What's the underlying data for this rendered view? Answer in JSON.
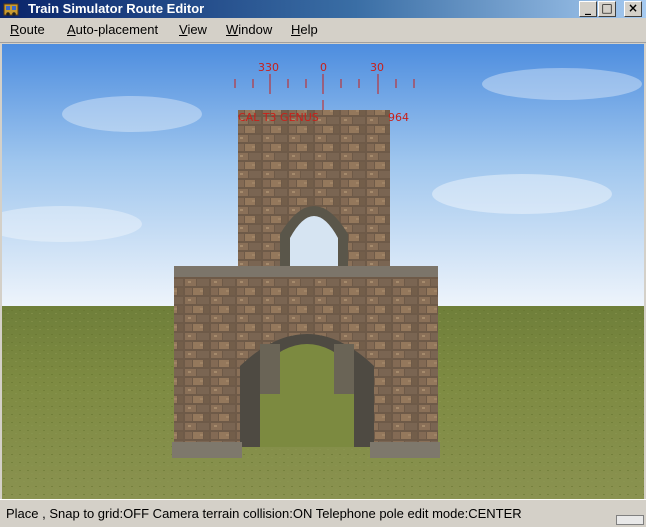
{
  "window": {
    "title": "Train Simulator Route Editor",
    "minimize_glyph": "_",
    "maximize_glyph": "□",
    "close_glyph": "×"
  },
  "menu": {
    "items": [
      {
        "label_first": "R",
        "label_rest": "oute"
      },
      {
        "label_first": "A",
        "label_rest": "uto-placement"
      },
      {
        "label_first": "V",
        "label_rest": "iew"
      },
      {
        "label_first": "W",
        "label_rest": "indow"
      },
      {
        "label_first": "H",
        "label_rest": "elp"
      }
    ]
  },
  "compass": {
    "labels": {
      "left": "330",
      "center": "0",
      "right": "30"
    },
    "readout_left": "CAL T3 GENUS",
    "readout_right": "964",
    "color": "#c8201a"
  },
  "status": {
    "text": "Place , Snap to grid:OFF Camera terrain collision:ON Telephone pole edit mode:CENTER"
  }
}
